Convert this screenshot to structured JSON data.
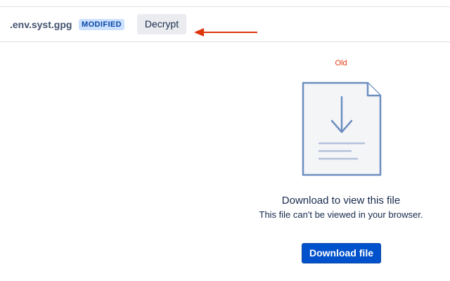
{
  "file_header": {
    "file_name": ".env.syst.gpg",
    "status_badge": "MODIFIED",
    "decrypt_label": "Decrypt"
  },
  "annotation": {
    "arrow_color": "#de350b"
  },
  "preview": {
    "version_label": "Old",
    "icon": "file-download-icon",
    "title": "Download to view this file",
    "subtitle": "This file can't be viewed in your browser.",
    "download_label": "Download file"
  },
  "colors": {
    "accent": "#0052cc",
    "badge_bg": "#cce0ff",
    "badge_text": "#0747a6",
    "version_label": "#de350b",
    "icon_stroke": "#6c8ebf"
  }
}
